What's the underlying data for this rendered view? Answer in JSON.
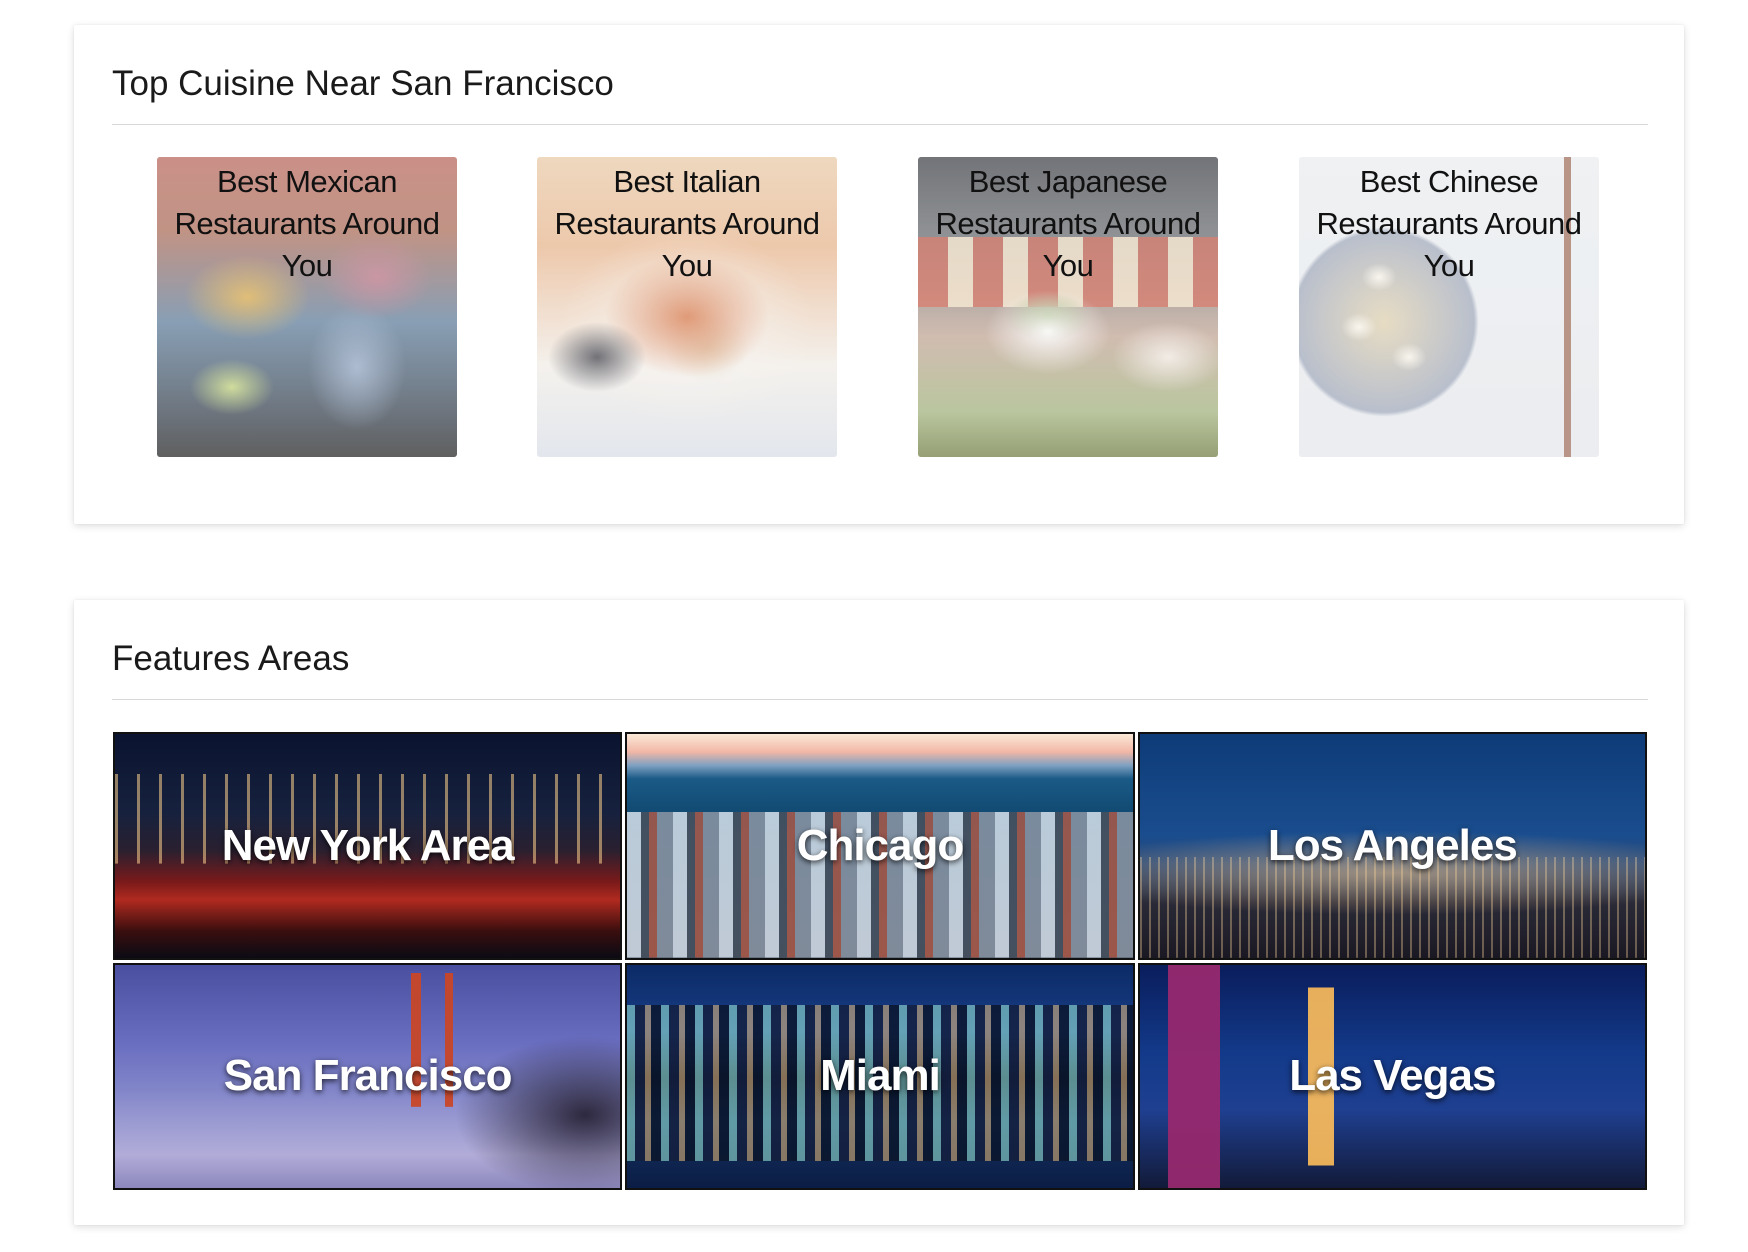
{
  "cuisine_section": {
    "title": "Top Cuisine Near San Francisco",
    "tiles": [
      {
        "label": "Best Mexican Restaurants Around You",
        "image": "mexican-tacos-photo"
      },
      {
        "label": "Best Italian Restaurants Around You",
        "image": "italian-seafood-pasta-photo"
      },
      {
        "label": "Best Japanese Restaurants Around You",
        "image": "japanese-sushi-photo"
      },
      {
        "label": "Best Chinese Restaurants Around You",
        "image": "chinese-dumpling-soup-photo"
      }
    ]
  },
  "areas_section": {
    "title": "Features Areas",
    "areas": [
      {
        "label": "New York Area",
        "image": "new-york-skyline-photo"
      },
      {
        "label": "Chicago",
        "image": "chicago-skyline-photo"
      },
      {
        "label": "Los Angeles",
        "image": "los-angeles-night-photo"
      },
      {
        "label": "San Francisco",
        "image": "golden-gate-bridge-photo"
      },
      {
        "label": "Miami",
        "image": "miami-skyline-reflection-photo"
      },
      {
        "label": "Las Vegas",
        "image": "las-vegas-eiffel-photo"
      }
    ]
  }
}
